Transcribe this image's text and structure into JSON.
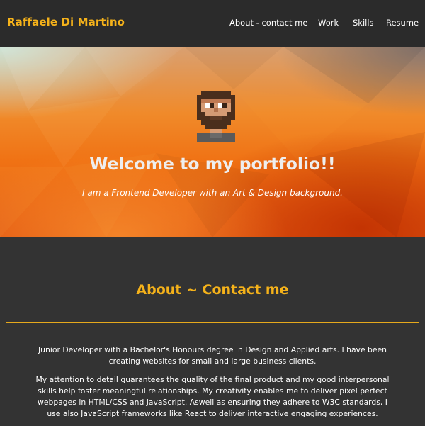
{
  "header": {
    "brand": "Raffaele Di Martino",
    "nav": [
      {
        "label": "About - contact me"
      },
      {
        "label": "Work"
      },
      {
        "label": "Skills"
      },
      {
        "label": "Resume"
      }
    ]
  },
  "hero": {
    "title": "Welcome to my portfolio!!",
    "subtitle": "I am a Frontend Developer with an Art & Design background.",
    "avatar_icon": "pixel-art-avatar"
  },
  "about": {
    "title": "About ~ Contact me",
    "paragraphs": [
      "Junior Developer with a Bachelor's Honours degree in Design and Applied arts. I have been creating websites for small and large business clients.",
      "My attention to detail guarantees the quality of the final product and my good interpersonal skills help foster meaningful relationships. My creativity enables me to deliver pixel perfect webpages in HTML/CSS and JavaScript. Aswell as ensuring they adhere to W3C standards, I use also JavaScript frameworks like React to deliver interactive engaging experiences."
    ]
  },
  "colors": {
    "accent": "#f5b21a",
    "nav_background": "#2b2b2b",
    "page_background": "#333333"
  }
}
